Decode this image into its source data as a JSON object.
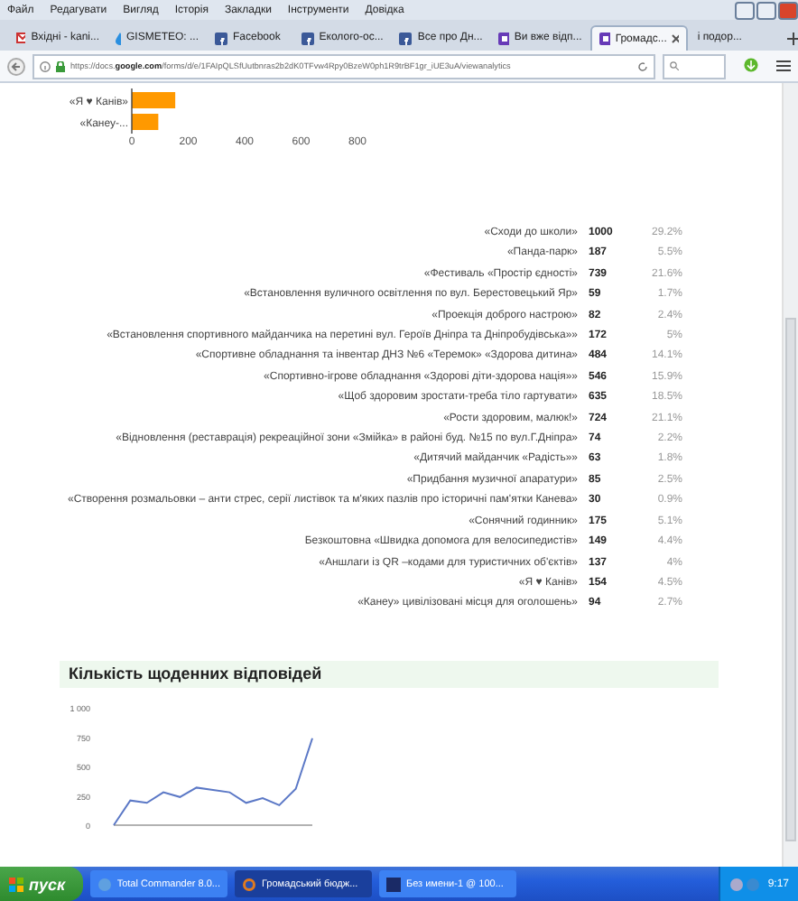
{
  "menu": [
    "Файл",
    "Редагувати",
    "Вигляд",
    "Історія",
    "Закладки",
    "Інструменти",
    "Довідка"
  ],
  "tabs": [
    {
      "label": "Вхідні - kani...",
      "kind": "mail",
      "selected": false
    },
    {
      "label": "GISMETEO: ...",
      "kind": "drop",
      "selected": false
    },
    {
      "label": "Facebook",
      "kind": "social",
      "selected": false
    },
    {
      "label": "Еколого-ос...",
      "kind": "social",
      "selected": false
    },
    {
      "label": "Все про Дн...",
      "kind": "social",
      "selected": false
    },
    {
      "label": "Ви вже відп...",
      "kind": "form",
      "selected": false
    },
    {
      "label": "Громадс...",
      "kind": "form",
      "selected": true
    },
    {
      "label": "і подор...",
      "kind": "page",
      "selected": false
    }
  ],
  "address_bar": {
    "url_start": "https://docs.",
    "url_domain": "google.com",
    "url_end": "/forms/d/e/1FAIpQLSfUutbnras2b2dK0TFvw4Rpy0BzeW0ph1R9trBF1gr_iUE3uA/viewanalytics"
  },
  "bar_chart": {
    "chart_data": {
      "type": "bar",
      "orientation": "horizontal",
      "categories": [
        "«Я ♥ Канів»",
        "«Канеу-..."
      ],
      "series": [
        {
          "color": "#ff9900",
          "values": [
            154,
            94
          ]
        }
      ],
      "xlim": [
        0,
        800
      ],
      "xticks": [
        0,
        200,
        400,
        600,
        800
      ]
    }
  },
  "responses": [
    {
      "label": "«Сходи до школи»",
      "count": "1000",
      "percent": "29.2%"
    },
    {
      "label": "«Панда-парк»",
      "count": "187",
      "percent": "5.5%"
    },
    {
      "label": "«Фестиваль «Простір єдності»",
      "count": "739",
      "percent": "21.6%"
    },
    {
      "label": "«Встановлення вуличного освітлення по вул. Берестовецький Яр»",
      "count": "59",
      "percent": "1.7%"
    },
    {
      "label": "«Проекція доброго настрою»",
      "count": "82",
      "percent": "2.4%"
    },
    {
      "label": "«Встановлення спортивного майданчика на перетині вул. Героїв Дніпра та Дніпробудівська»»",
      "count": "172",
      "percent": "5%"
    },
    {
      "label": "«Спортивне обладнання та інвентар ДНЗ №6 «Теремок» «Здорова дитина»",
      "count": "484",
      "percent": "14.1%"
    },
    {
      "label": "«Спортивно-ігрове обладнання «Здорові діти-здорова нація»»",
      "count": "546",
      "percent": "15.9%"
    },
    {
      "label": "«Щоб здоровим зростати-треба тіло гартувати»",
      "count": "635",
      "percent": "18.5%"
    },
    {
      "label": "«Рости здоровим, малюк!»",
      "count": "724",
      "percent": "21.1%"
    },
    {
      "label": "«Відновлення (реставрація) рекреаційної зони «Змійка» в районі буд. №15 по вул.Г.Дніпра»",
      "count": "74",
      "percent": "2.2%"
    },
    {
      "label": "«Дитячий майданчик «Радість»»",
      "count": "63",
      "percent": "1.8%"
    },
    {
      "label": "«Придбання музичної апаратури»",
      "count": "85",
      "percent": "2.5%"
    },
    {
      "label": "«Створення розмальовки – анти стрес, серії листівок та м'яких пазлів про історичні пам'ятки Канева»",
      "count": "30",
      "percent": "0.9%"
    },
    {
      "label": "«Сонячний годинник»",
      "count": "175",
      "percent": "5.1%"
    },
    {
      "label": "Безкоштовна «Швидка допомога для велосипедистів»",
      "count": "149",
      "percent": "4.4%"
    },
    {
      "label": "«Аншлаги із QR –кодами для туристичних об'єктів»",
      "count": "137",
      "percent": "4%"
    },
    {
      "label": "«Я ♥ Канів»",
      "count": "154",
      "percent": "4.5%"
    },
    {
      "label": "«Канеу» цивілізовані місця для оголошень»",
      "count": "94",
      "percent": "2.7%"
    }
  ],
  "daily": {
    "title": "Кількість щоденних відповідей",
    "chart_data": {
      "type": "line",
      "ylim": [
        0,
        1000
      ],
      "yticks": [
        0,
        250,
        500,
        750,
        {
          "value": 1000,
          "label": "1 000"
        }
      ],
      "series": [
        {
          "color": "#5b78c6",
          "values": [
            0,
            210,
            190,
            280,
            240,
            320,
            300,
            280,
            190,
            230,
            170,
            310,
            740
          ]
        }
      ]
    }
  },
  "taskbar": {
    "start": "пуск",
    "tasks": [
      {
        "label": "Total Commander 8.0...",
        "kind": "app",
        "selected": false
      },
      {
        "label": "Громадський бюдж...",
        "kind": "browser",
        "selected": true
      },
      {
        "label": "Без имени-1 @ 100...",
        "kind": "editor",
        "selected": false
      }
    ],
    "clock": "9:17"
  }
}
